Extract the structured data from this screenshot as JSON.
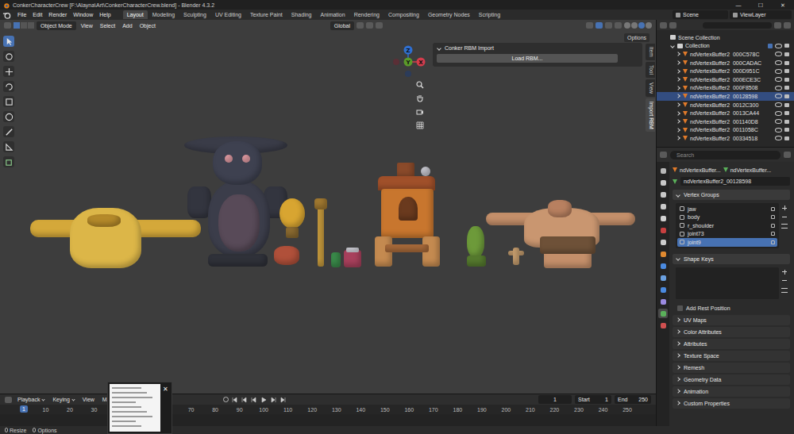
{
  "window": {
    "title": "ConkerCharacterCrew [F:\\Alayna\\Art\\ConkerCharacterCrew.blend] - Blender 4.3.2",
    "controls": [
      "—",
      "☐",
      "✕"
    ]
  },
  "menu": [
    "File",
    "Edit",
    "Render",
    "Window",
    "Help"
  ],
  "workspaces": [
    {
      "label": "Layout",
      "selected": true
    },
    {
      "label": "Modeling",
      "selected": false
    },
    {
      "label": "Sculpting",
      "selected": false
    },
    {
      "label": "UV Editing",
      "selected": false
    },
    {
      "label": "Texture Paint",
      "selected": false
    },
    {
      "label": "Shading",
      "selected": false
    },
    {
      "label": "Animation",
      "selected": false
    },
    {
      "label": "Rendering",
      "selected": false
    },
    {
      "label": "Compositing",
      "selected": false
    },
    {
      "label": "Geometry Nodes",
      "selected": false
    },
    {
      "label": "Scripting",
      "selected": false
    }
  ],
  "scene": "Scene",
  "view_layer": "ViewLayer",
  "viewport": {
    "mode": "Object Mode",
    "menus": [
      "View",
      "Select",
      "Add",
      "Object"
    ],
    "orientation": "Global",
    "options": "Options",
    "tools": [
      {
        "selected": true
      },
      {
        "selected": false
      },
      {
        "selected": false
      },
      {
        "selected": false
      },
      {
        "selected": false
      },
      {
        "selected": false
      },
      {
        "selected": false
      },
      {
        "selected": false
      },
      {
        "selected": false
      }
    ],
    "gizmo": [
      {
        "label": "Z",
        "color": "#2f6fd1"
      },
      {
        "label": "Y",
        "color": "#5a9a2a"
      },
      {
        "label": "X",
        "color": "#d43c4c"
      }
    ]
  },
  "side_panel": {
    "title": "Conker RBM Import",
    "expanded": true,
    "button": "Load RBM...",
    "tabs": [
      {
        "label": "Item",
        "selected": false
      },
      {
        "label": "Tool",
        "selected": false
      },
      {
        "label": "View",
        "selected": false
      },
      {
        "label": "Import RBM",
        "selected": true
      }
    ]
  },
  "outliner": {
    "root": "Scene Collection",
    "collection": "Collection",
    "collection_checked": true,
    "items": [
      {
        "name": "ndVertexBuffer2_000C578C",
        "selected": false
      },
      {
        "name": "ndVertexBuffer2_000CADAC",
        "selected": false
      },
      {
        "name": "ndVertexBuffer2_000D951C",
        "selected": false
      },
      {
        "name": "ndVertexBuffer2_000ECE3C",
        "selected": false
      },
      {
        "name": "ndVertexBuffer2_000F8508",
        "selected": false
      },
      {
        "name": "ndVertexBuffer2_00128598",
        "selected": true
      },
      {
        "name": "ndVertexBuffer2_0012C300",
        "selected": false
      },
      {
        "name": "ndVertexBuffer2_0013CA44",
        "selected": false
      },
      {
        "name": "ndVertexBuffer2_001140D8",
        "selected": false
      },
      {
        "name": "ndVertexBuffer2_0011058C",
        "selected": false
      },
      {
        "name": "ndVertexBuffer2_00334518",
        "selected": false
      }
    ]
  },
  "properties": {
    "search": "Search",
    "breadcrumb": [
      "ndVertexBuffer...",
      "ndVertexBuffer..."
    ],
    "name": "ndVertexBuffer2_00128598",
    "tabs": [
      {
        "selected": false
      },
      {
        "selected": false
      },
      {
        "selected": false
      },
      {
        "selected": false
      },
      {
        "selected": false
      },
      {
        "selected": false
      },
      {
        "selected": false
      },
      {
        "selected": false
      },
      {
        "selected": false
      },
      {
        "selected": false
      },
      {
        "selected": false
      },
      {
        "selected": false
      },
      {
        "selected": true
      },
      {
        "selected": false
      }
    ],
    "vertex_groups": {
      "title": "Vertex Groups",
      "expanded": true,
      "items": [
        {
          "name": "jaw",
          "selected": false
        },
        {
          "name": "body",
          "selected": false
        },
        {
          "name": "r_shoulder",
          "selected": false
        },
        {
          "name": "joint73",
          "selected": false
        },
        {
          "name": "joint9",
          "selected": true
        }
      ]
    },
    "shape_keys": {
      "title": "Shape Keys",
      "expanded": true
    },
    "add_rest_position": {
      "label": "Add Rest Position",
      "checked": false
    },
    "panels": [
      "UV Maps",
      "Color Attributes",
      "Attributes",
      "Texture Space",
      "Remesh",
      "Geometry Data",
      "Animation",
      "Custom Properties"
    ]
  },
  "timeline": {
    "menus": [
      "Playback",
      "Keying",
      "View",
      "Mar"
    ],
    "current_frame": "1",
    "start_label": "Start",
    "start": "1",
    "end_label": "End",
    "end": "250",
    "playhead": "1",
    "ruler": [
      "10",
      "20",
      "30",
      "70",
      "80",
      "90",
      "100",
      "110",
      "120",
      "130",
      "140",
      "150",
      "160",
      "170",
      "180",
      "190",
      "200",
      "210",
      "220",
      "230",
      "240",
      "250"
    ]
  },
  "thumbnail": {
    "close": "✕"
  },
  "status_bar": [
    "Resize",
    "Options"
  ]
}
